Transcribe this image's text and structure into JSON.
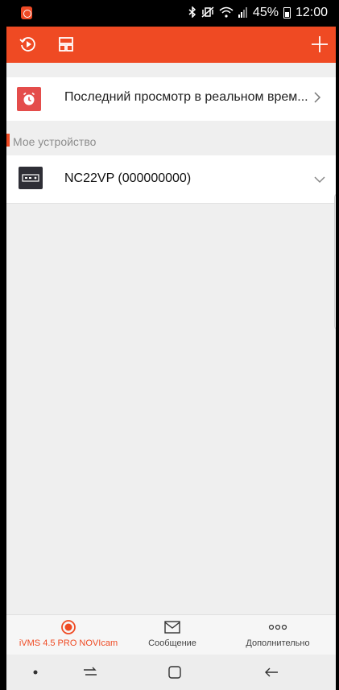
{
  "status_bar": {
    "battery": "45%",
    "time": "12:00",
    "bluetooth_icon": "bluetooth-icon",
    "mute_icon": "vibrate-mute-icon",
    "wifi_icon": "wifi-icon",
    "signal_icon": "signal-icon",
    "battery_icon": "battery-icon",
    "app_icon": "app-notification-icon"
  },
  "app_bar": {
    "background_color": "#ef4a23",
    "left_icons": [
      "playback-icon",
      "layout-icon"
    ],
    "right_icon": "add-icon"
  },
  "recent": {
    "label": "Последний просмотр в реальном врем...",
    "icon": "clock-icon",
    "icon_color": "#e44d4b"
  },
  "section": {
    "title": "Мое устройство",
    "accent_color": "#ef4a23"
  },
  "devices": [
    {
      "name": "NC22VP (000000000)",
      "icon": "dvr-icon"
    }
  ],
  "bottom_nav": {
    "items": [
      {
        "label": "iVMS 4.5 PRO NOVIcam",
        "icon": "live-view-icon",
        "active": true
      },
      {
        "label": "Сообщение",
        "icon": "message-icon",
        "active": false
      },
      {
        "label": "Дополнительно",
        "icon": "more-icon",
        "active": false
      }
    ]
  },
  "system_nav": [
    "dot-indicator",
    "recent-apps-icon",
    "home-icon",
    "back-icon"
  ]
}
